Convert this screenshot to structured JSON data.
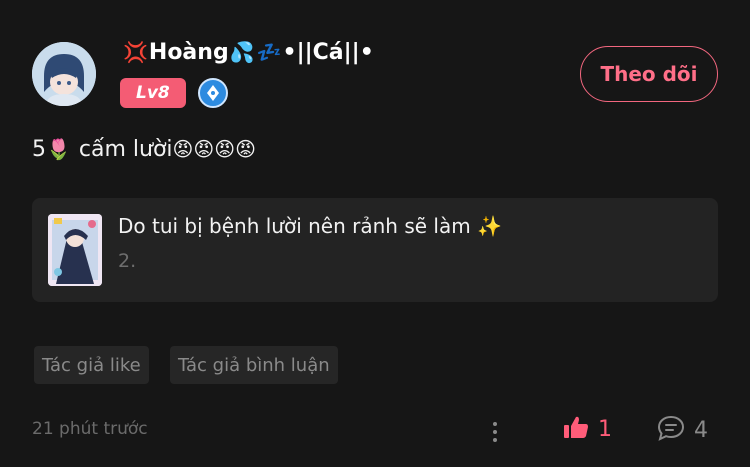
{
  "user": {
    "emoji_anger": "💢",
    "name_part1": "Hoàng",
    "emoji_sweat": "💦",
    "emoji_zzz": "💤",
    "name_part2": "•||Cá||•",
    "level": "Lv8"
  },
  "follow_button": {
    "label": "Theo dõi"
  },
  "post": {
    "number": "5",
    "emoji_tulip": "🌷",
    "text": "cấm lười",
    "emoji_angry": "😡😡😡😡"
  },
  "book": {
    "title": "Do tui bị bệnh lười nên rảnh sẽ làm ✨",
    "subtitle": "2."
  },
  "tags": [
    "Tác giả like",
    "Tác giả bình luận"
  ],
  "footer": {
    "time": "21 phút trước",
    "likes": "1",
    "comments": "4"
  },
  "colors": {
    "accent": "#ff5c79",
    "level_badge": "#f45c74",
    "background": "#161616"
  }
}
